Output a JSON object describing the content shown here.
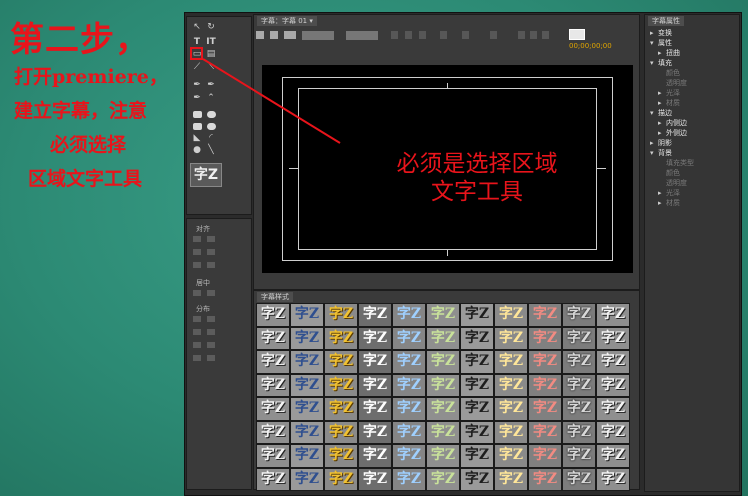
{
  "instructions": {
    "step_title": "第二步，",
    "lines": [
      "打开premiere，",
      "建立字幕，注意",
      "必须选择",
      "区域文字工具"
    ]
  },
  "editor": {
    "tab_title": "字幕：字幕 01",
    "timecode": "00;00;00;00",
    "annotation_line1": "必须是选择区域",
    "annotation_line2": "文字工具"
  },
  "tools": {
    "big_tool_label": "字Z"
  },
  "align_panel": {
    "label_align": "对齐",
    "label_center": "居中",
    "label_distribute": "分布"
  },
  "styles_panel": {
    "tab_title": "字幕样式"
  },
  "properties_panel": {
    "tab_title": "字幕属性",
    "items": [
      {
        "label": "变换",
        "arrow": "▸",
        "dim": false,
        "indent": 0
      },
      {
        "label": "属性",
        "arrow": "▾",
        "dim": false,
        "indent": 0
      },
      {
        "label": "扭曲",
        "arrow": "▸",
        "dim": false,
        "indent": 1
      },
      {
        "label": "填充",
        "arrow": "▾",
        "dim": false,
        "indent": 0
      },
      {
        "label": "颜色",
        "arrow": "",
        "dim": true,
        "indent": 1
      },
      {
        "label": "透明度",
        "arrow": "",
        "dim": true,
        "indent": 1
      },
      {
        "label": "光泽",
        "arrow": "▸",
        "dim": true,
        "indent": 1
      },
      {
        "label": "材质",
        "arrow": "▸",
        "dim": true,
        "indent": 1
      },
      {
        "label": "描边",
        "arrow": "▾",
        "dim": false,
        "indent": 0
      },
      {
        "label": "内侧边",
        "arrow": "▸",
        "dim": false,
        "indent": 1
      },
      {
        "label": "外侧边",
        "arrow": "▸",
        "dim": false,
        "indent": 1
      },
      {
        "label": "阴影",
        "arrow": "▸",
        "dim": false,
        "indent": 0
      },
      {
        "label": "背景",
        "arrow": "▾",
        "dim": false,
        "indent": 0
      },
      {
        "label": "填充类型",
        "arrow": "",
        "dim": true,
        "indent": 1
      },
      {
        "label": "颜色",
        "arrow": "",
        "dim": true,
        "indent": 1
      },
      {
        "label": "透明度",
        "arrow": "",
        "dim": true,
        "indent": 1
      },
      {
        "label": "光泽",
        "arrow": "▸",
        "dim": true,
        "indent": 1
      },
      {
        "label": "材质",
        "arrow": "▸",
        "dim": true,
        "indent": 1
      }
    ]
  },
  "style_swatches": [
    "字Z",
    "字Z",
    "字Z",
    "字Z",
    "字Z",
    "字Z",
    "字Z",
    "字Z",
    "字Z",
    "字Z",
    "字Z",
    "字Z",
    "字Z",
    "字Z",
    "字Z",
    "字Z",
    "字Z",
    "字Z",
    "字Z",
    "字Z",
    "字Z",
    "字Z",
    "字Z",
    "字Z",
    "字Z",
    "字Z",
    "字Z",
    "字Z",
    "字Z",
    "字Z",
    "字Z",
    "字Z",
    "字Z",
    "字Z",
    "字Z",
    "字Z",
    "字Z",
    "字Z",
    "字Z",
    "字Z",
    "字Z",
    "字Z",
    "字Z",
    "字Z",
    "字Z",
    "字Z",
    "字Z",
    "字Z",
    "字Z",
    "字Z",
    "字Z",
    "字Z",
    "字Z",
    "字Z",
    "字Z",
    "字Z",
    "字Z",
    "字Z",
    "字Z",
    "字Z",
    "字Z",
    "字Z",
    "字Z",
    "字Z",
    "字Z",
    "字Z",
    "字Z",
    "字Z",
    "字Z",
    "字Z",
    "字Z",
    "字Z",
    "字Z",
    "字Z",
    "字Z",
    "字Z",
    "字Z",
    "字Z",
    "字Z",
    "字Z",
    "字Z",
    "字Z",
    "字Z",
    "字Z",
    "字Z",
    "字Z",
    "字Z",
    "字Z"
  ],
  "colors": {
    "annotation_red": "#e8141b",
    "slide_background": "#2e8f7a",
    "timecode": "#e0a500"
  }
}
